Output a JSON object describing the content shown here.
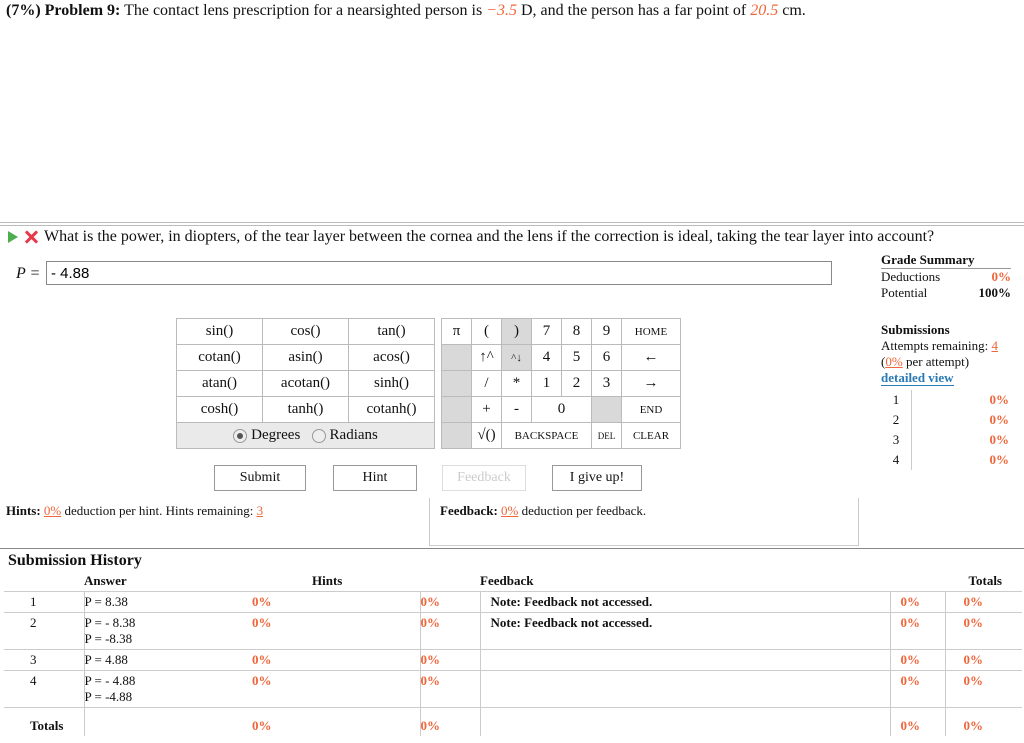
{
  "problem": {
    "weight": "(7%)",
    "label": "Problem 9:",
    "text_before": "The contact lens prescription for a nearsighted person is",
    "prescription": "−3.5",
    "text_mid": "D, and the person has a far point of",
    "far_point": "20.5",
    "text_end": "cm."
  },
  "question": {
    "text": "What is the power, in diopters, of the tear layer between the cornea and the lens if the correction is ideal, taking the tear layer into account?",
    "var_label": "P =",
    "answer_value": "- 4.88"
  },
  "keypad": {
    "functions": [
      [
        "sin()",
        "cos()",
        "tan()"
      ],
      [
        "cotan()",
        "asin()",
        "acos()"
      ],
      [
        "atan()",
        "acotan()",
        "sinh()"
      ],
      [
        "cosh()",
        "tanh()",
        "cotanh()"
      ]
    ],
    "row1": [
      "π",
      "(",
      ")",
      "7",
      "8",
      "9",
      "HOME"
    ],
    "row2": [
      "↑^",
      "^↓",
      "4",
      "5",
      "6",
      "←"
    ],
    "row3": [
      "/",
      "*",
      "1",
      "2",
      "3",
      "→"
    ],
    "row4": [
      "+",
      "-",
      "0",
      "END"
    ],
    "row5": [
      "√()",
      "BACKSPACE",
      "DEL",
      "CLEAR"
    ],
    "degrees": "Degrees",
    "radians": "Radians"
  },
  "buttons": {
    "submit": "Submit",
    "hint": "Hint",
    "feedback": "Feedback",
    "give_up": "I give up!"
  },
  "hints": {
    "label": "Hints:",
    "pct": "0%",
    "text": "deduction per hint. Hints remaining:",
    "remaining": "3"
  },
  "feedback": {
    "label": "Feedback:",
    "pct": "0%",
    "text": "deduction per feedback."
  },
  "grade_summary": {
    "title": "Grade Summary",
    "deductions_label": "Deductions",
    "deductions": "0%",
    "potential_label": "Potential",
    "potential": "100%"
  },
  "submissions": {
    "title": "Submissions",
    "attempts_text": "Attempts remaining:",
    "attempts": "4",
    "per_attempt_pct": "0%",
    "per_attempt_text": "per attempt)",
    "detailed_view": "detailed view",
    "rows": [
      [
        "1",
        "0%"
      ],
      [
        "2",
        "0%"
      ],
      [
        "3",
        "0%"
      ],
      [
        "4",
        "0%"
      ]
    ]
  },
  "history": {
    "title": "Submission History",
    "headers": {
      "answer": "Answer",
      "hints": "Hints",
      "feedback": "Feedback",
      "totals": "Totals"
    },
    "rows": [
      {
        "n": "1",
        "answer": [
          "P = 8.38"
        ],
        "a_pct": "0%",
        "h_pct": "0%",
        "feedback": "Note: Feedback not accessed.",
        "f_pct": "0%",
        "t_pct": "0%"
      },
      {
        "n": "2",
        "answer": [
          "P = - 8.38",
          "P = -8.38"
        ],
        "a_pct": "0%",
        "h_pct": "0%",
        "feedback": "Note: Feedback not accessed.",
        "f_pct": "0%",
        "t_pct": "0%"
      },
      {
        "n": "3",
        "answer": [
          "P = 4.88"
        ],
        "a_pct": "0%",
        "h_pct": "0%",
        "feedback": "",
        "f_pct": "0%",
        "t_pct": "0%"
      },
      {
        "n": "4",
        "answer": [
          "P = - 4.88",
          "P = -4.88"
        ],
        "a_pct": "0%",
        "h_pct": "0%",
        "feedback": "",
        "f_pct": "0%",
        "t_pct": "0%"
      }
    ],
    "totals": {
      "label": "Totals",
      "a_pct": "0%",
      "h_pct": "0%",
      "f_pct": "0%",
      "t_pct": "0%"
    }
  },
  "colors": {
    "accent": "#f0663a",
    "link": "#2a7ab5",
    "ok_arrow": "#4cae4c",
    "error_x": "#e8394a"
  }
}
